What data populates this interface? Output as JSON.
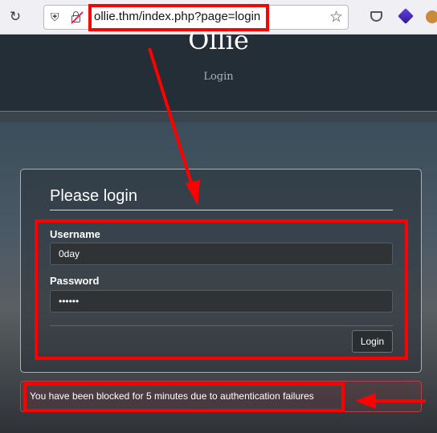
{
  "browser": {
    "url": "ollie.thm/index.php?page=login",
    "icons": [
      "reload-icon",
      "shield-icon",
      "insecure-lock-icon",
      "bookmark-star-icon",
      "pocket-icon",
      "extension-icon",
      "cookie-extension-icon"
    ]
  },
  "site": {
    "title": "Ollie",
    "subtitle": "Login"
  },
  "login": {
    "heading": "Please login",
    "username_label": "Username",
    "username_value": "0day",
    "password_label": "Password",
    "password_value": "••••••",
    "submit_label": "Login"
  },
  "alert": {
    "message": "You have been blocked for 5 minutes due to authentication failures"
  },
  "colors": {
    "annotation": "#ff0000",
    "alert_border": "#b5414a",
    "header_bg": "#232e36"
  }
}
